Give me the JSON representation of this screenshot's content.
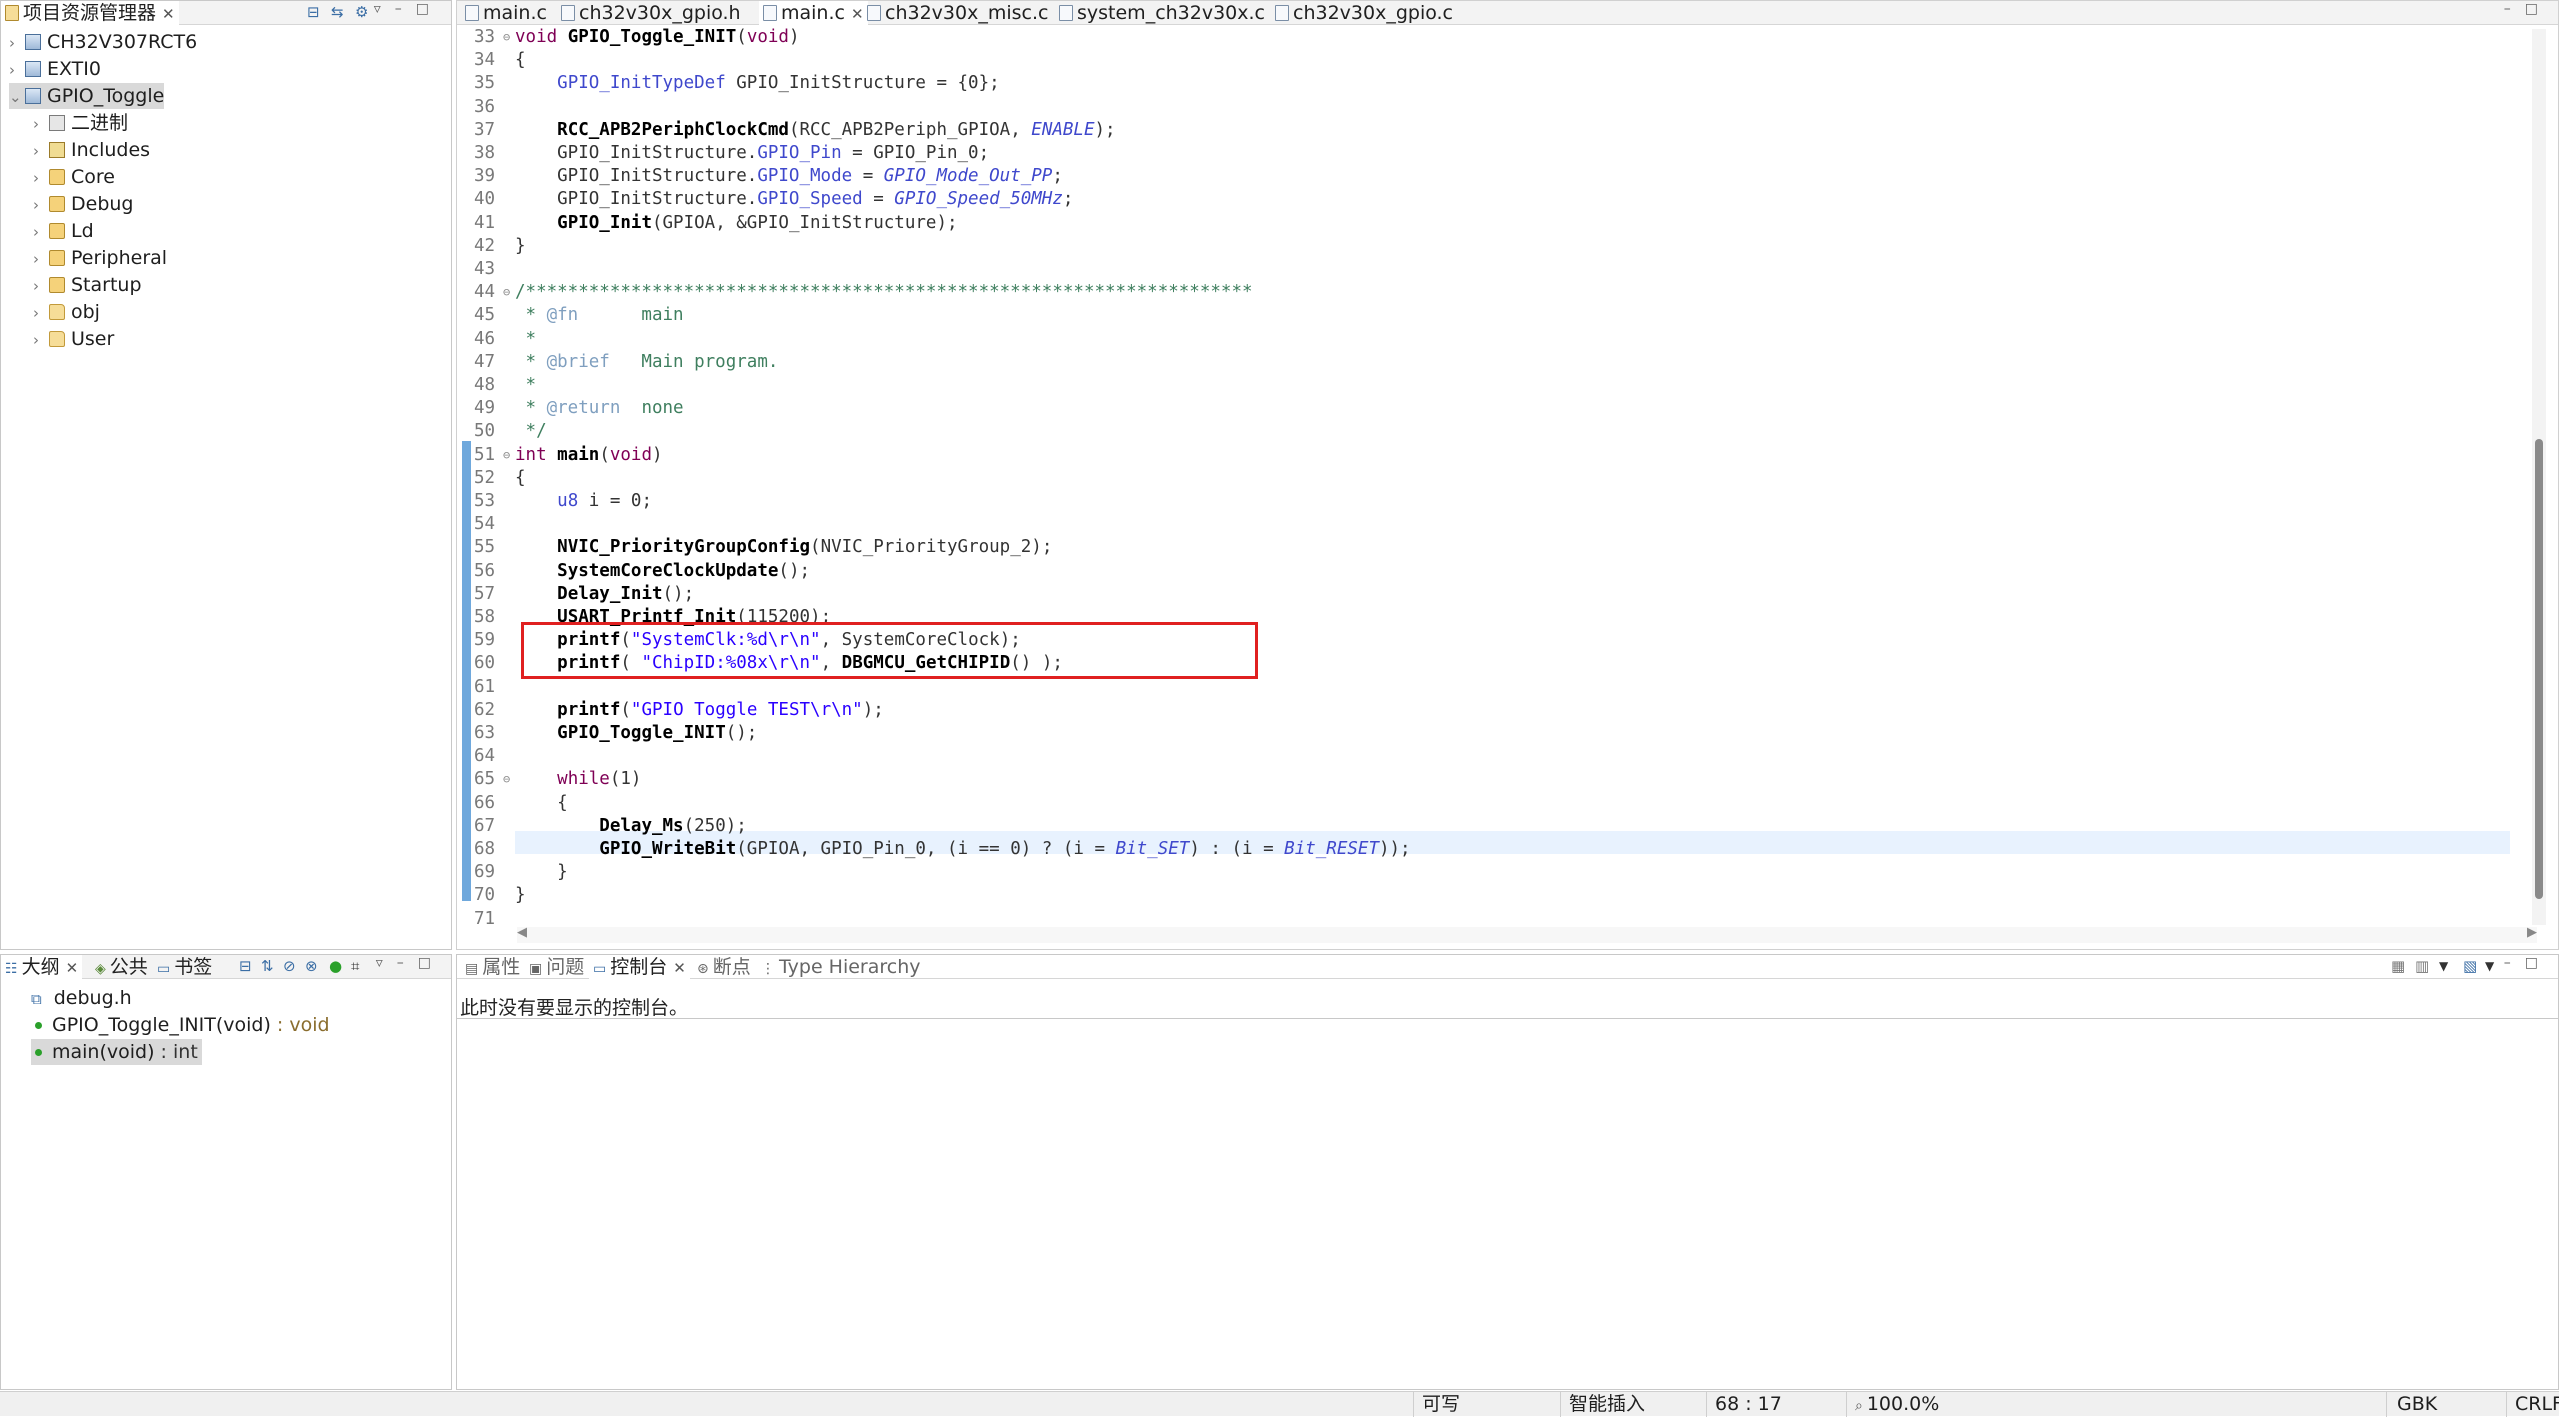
{
  "project_explorer": {
    "title": "项目资源管理器",
    "items": [
      {
        "label": "CH32V307RCT6"
      },
      {
        "label": "EXTI0"
      },
      {
        "label": "GPIO_Toggle"
      },
      {
        "label": "二进制"
      },
      {
        "label": "Includes"
      },
      {
        "label": "Core"
      },
      {
        "label": "Debug"
      },
      {
        "label": "Ld"
      },
      {
        "label": "Peripheral"
      },
      {
        "label": "Startup"
      },
      {
        "label": "obj"
      },
      {
        "label": "User"
      }
    ]
  },
  "editor": {
    "tabs": [
      {
        "label": "main.c"
      },
      {
        "label": "ch32v30x_gpio.h"
      },
      {
        "label": "main.c"
      },
      {
        "label": "ch32v30x_misc.c"
      },
      {
        "label": "system_ch32v30x.c"
      },
      {
        "label": "ch32v30x_gpio.c"
      }
    ],
    "line_numbers": [
      "33",
      "34",
      "35",
      "36",
      "37",
      "38",
      "39",
      "40",
      "41",
      "42",
      "43",
      "44",
      "45",
      "46",
      "47",
      "48",
      "49",
      "50",
      "51",
      "52",
      "53",
      "54",
      "55",
      "56",
      "57",
      "58",
      "59",
      "60",
      "61",
      "62",
      "63",
      "64",
      "65",
      "66",
      "67",
      "68",
      "69",
      "70",
      "71"
    ]
  },
  "outline": {
    "tabs": [
      "大纲",
      "公共",
      "书签"
    ],
    "items": [
      {
        "label": "debug.h"
      },
      {
        "label": "GPIO_Toggle_INIT(void)",
        "ret": " : void"
      },
      {
        "label": "main(void)",
        "ret": " : int"
      }
    ]
  },
  "console": {
    "tabs": [
      "属性",
      "问题",
      "控制台",
      "断点",
      "Type Hierarchy"
    ],
    "message": "此时没有要显示的控制台。"
  },
  "status_bar": {
    "writable": "可写",
    "insert_mode": "智能插入",
    "position": "68 : 17",
    "zoom": "100.0%",
    "encoding": "GBK",
    "line_ending": "CRLF"
  },
  "colors": {
    "highlight_box": "#e02020",
    "current_line": "#e8f2fe",
    "keyword": "#7f0055",
    "string": "#2a00ff"
  }
}
